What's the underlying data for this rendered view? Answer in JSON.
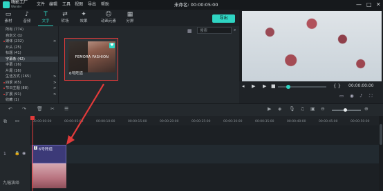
{
  "app": {
    "name": "嗨影工厂",
    "subtitle": "Wonder"
  },
  "menu": [
    "文件",
    "编辑",
    "工具",
    "视图",
    "导出",
    "帮助"
  ],
  "document_title": "未命名: 00:00:05:00",
  "window_controls": [
    "—",
    "□",
    "✕"
  ],
  "tabs": [
    {
      "label": "素材",
      "icon": "folder-icon",
      "glyph": "▭"
    },
    {
      "label": "音频",
      "icon": "music-icon",
      "glyph": "♪"
    },
    {
      "label": "文字",
      "icon": "text-icon",
      "glyph": "T"
    },
    {
      "label": "转场",
      "icon": "transition-icon",
      "glyph": "⇄"
    },
    {
      "label": "效果",
      "icon": "effect-icon",
      "glyph": "✦"
    },
    {
      "label": "动画元素",
      "icon": "animation-icon",
      "glyph": "☺"
    },
    {
      "label": "分屏",
      "icon": "split-screen-icon",
      "glyph": "▦"
    }
  ],
  "export_label": "导出",
  "categories": [
    {
      "label": "所有 (774)",
      "arrow": "",
      "dot": false
    },
    {
      "label": "自定义 (1)",
      "arrow": "",
      "dot": false
    },
    {
      "label": "媒体 (232)",
      "arrow": ">",
      "dot": true
    },
    {
      "label": "片头 (25)",
      "arrow": "",
      "dot": false
    },
    {
      "label": "标题 (41)",
      "arrow": "",
      "dot": false
    },
    {
      "label": "字幕条 (42)",
      "arrow": "",
      "dot": false
    },
    {
      "label": "字幕 (16)",
      "arrow": "",
      "dot": false
    },
    {
      "label": "片尾 (16)",
      "arrow": "",
      "dot": false
    },
    {
      "label": "生活方式 (165)",
      "arrow": ">",
      "dot": false
    },
    {
      "label": "四季 (65)",
      "arrow": ">",
      "dot": true
    },
    {
      "label": "节日主题 (88)",
      "arrow": ">",
      "dot": true
    },
    {
      "label": "扩展 (91)",
      "arrow": ">",
      "dot": true
    },
    {
      "label": "收藏 (1)",
      "arrow": "",
      "dot": false
    }
  ],
  "search_placeholder": "搜索",
  "media_card": {
    "thumb_text": "FEMORA FASHION",
    "label": "6号阵道"
  },
  "preview": {
    "time": "00:00:00:00"
  },
  "timeline": {
    "ticks": [
      "00:00:00:00",
      "00:00:05:00",
      "00:00:10:00",
      "00:00:15:00",
      "00:00:20:00",
      "00:00:25:00",
      "00:00:30:00",
      "00:00:35:00",
      "00:00:40:00",
      "00:00:45:00",
      "00:00:50:00"
    ],
    "track_number": "1",
    "clip_label": "6号阵道"
  },
  "watermark": "九幅演绎"
}
